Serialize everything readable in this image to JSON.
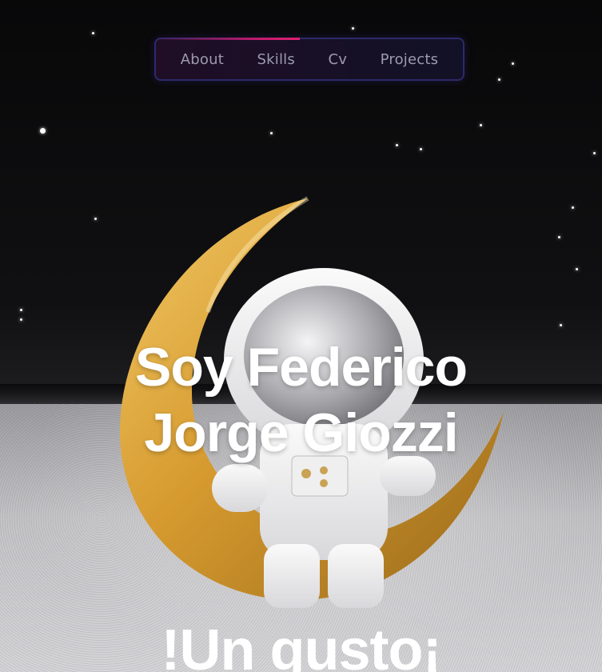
{
  "nav": {
    "items": [
      {
        "label": "About"
      },
      {
        "label": "Skills"
      },
      {
        "label": "Cv"
      },
      {
        "label": "Projects"
      }
    ]
  },
  "hero": {
    "title_line1": "Soy Federico",
    "title_line2": "Jorge Giozzi",
    "subtitle": "!Un gusto¡",
    "background_image": "astronaut-on-crescent-moon"
  },
  "colors": {
    "nav_border": "#2d2a6a",
    "nav_accent": "#c21b6e",
    "nav_text": "#9d9aae",
    "title_text": "#ffffff"
  }
}
